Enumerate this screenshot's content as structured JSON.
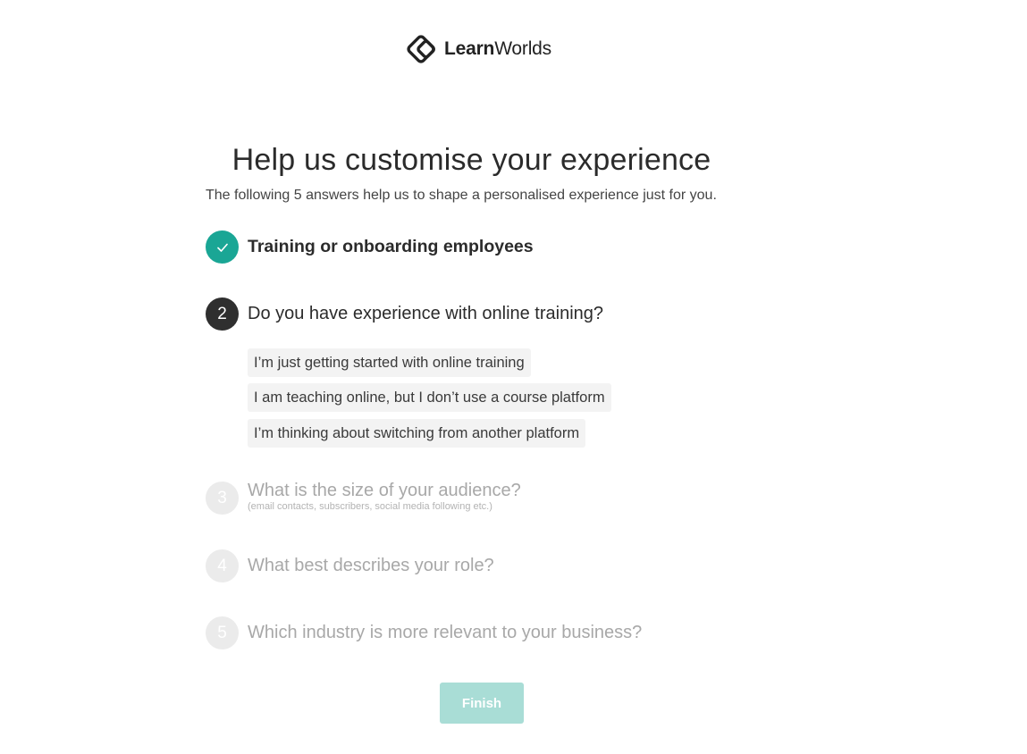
{
  "brand": {
    "name_bold": "Learn",
    "name_light": "Worlds",
    "logo_icon": "learnworlds-diamond-logo-icon"
  },
  "header": {
    "title": "Help us customise your experience",
    "subtitle": "The following 5 answers help us to shape a personalised experience just for you."
  },
  "steps": [
    {
      "number": "1",
      "state": "completed",
      "icon": "check-icon",
      "label": "Training or onboarding employees"
    },
    {
      "number": "2",
      "state": "active",
      "label": "Do you have experience with online training?"
    },
    {
      "number": "3",
      "state": "pending",
      "label": "What is the size of your audience?",
      "note": "(email contacts, subscribers, social media following etc.)"
    },
    {
      "number": "4",
      "state": "pending",
      "label": "What best describes your role?"
    },
    {
      "number": "5",
      "state": "pending",
      "label": "Which industry is more relevant to your business?"
    }
  ],
  "options": [
    "I’m just getting started with online training",
    "I am teaching online, but I don’t use a course platform",
    "I’m thinking about switching from another platform"
  ],
  "finish_label": "Finish",
  "colors": {
    "accent": "#1aa695",
    "active_step": "#2f2f2f",
    "pending_step": "#ebebeb",
    "finish_disabled": "#a9ddd6",
    "option_bg": "#f3f3f3"
  }
}
